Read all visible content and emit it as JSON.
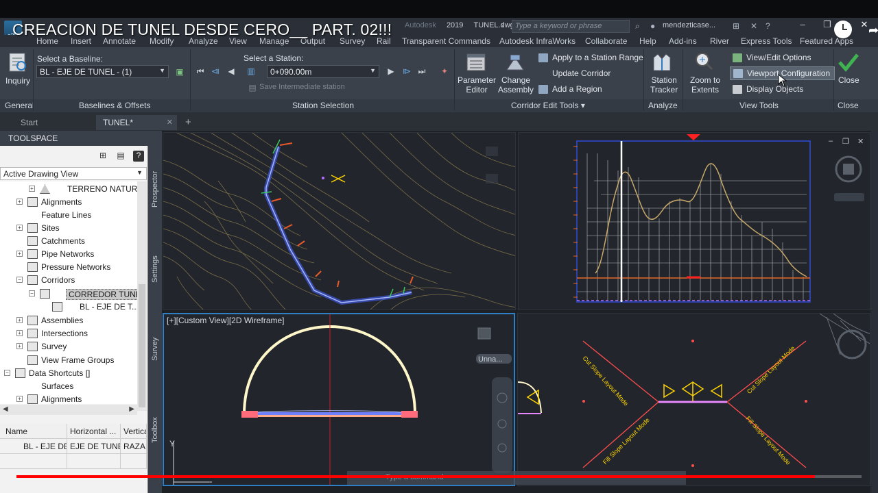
{
  "video_title": "CREACION DE TUNEL DESDE CERO__ PART. 02!!!",
  "window": {
    "app_logo": "c3D",
    "title_year_fragment": "2019",
    "title_file": "TUNEL.dwg",
    "title_prefix": "Autodesk",
    "search_placeholder": "Type a keyword or phrase",
    "user": "mendezticase..."
  },
  "ribbon_tabs": [
    "Home",
    "Insert",
    "Annotate",
    "Modify",
    "Analyze",
    "View",
    "Manage",
    "Output",
    "Survey",
    "Rail",
    "Transparent Commands",
    "Autodesk InfraWorks",
    "Collaborate",
    "Help",
    "Add-ins",
    "River",
    "Express Tools",
    "Featured Apps"
  ],
  "ribbon": {
    "general": {
      "inquiry_label": "Inquiry",
      "panel_title": "General"
    },
    "baselines": {
      "select_label": "Select a Baseline:",
      "baseline_value": "BL - EJE DE TUNEL - (1)",
      "panel_title": "Baselines & Offsets"
    },
    "station": {
      "select_label": "Select a Station:",
      "station_value": "0+090.00m",
      "save_label": "Save Intermediate station",
      "panel_title": "Station Selection"
    },
    "corridor_edit": {
      "parameter_editor": "Parameter\nEditor",
      "change_assembly": "Change\nAssembly",
      "apply_range": "Apply to a Station Range",
      "update_corridor": "Update Corridor",
      "add_region": "Add a Region",
      "panel_title": "Corridor Edit Tools ▾"
    },
    "analyze": {
      "station_tracker": "Station\nTracker",
      "panel_title": "Analyze"
    },
    "view_tools": {
      "zoom_extents": "Zoom to\nExtents",
      "view_edit_options": "View/Edit Options",
      "viewport_config": "Viewport Configuration",
      "display_objects": "Display Objects",
      "panel_title": "View Tools"
    },
    "close": {
      "label": "Close",
      "panel_title": "Close"
    }
  },
  "doc_tabs": {
    "start": "Start",
    "tunel": "TUNEL*",
    "add": "+"
  },
  "toolspace": {
    "title": "TOOLSPACE",
    "view_combo": "Active Drawing View",
    "side_tabs": [
      "Prospector",
      "Settings",
      "Survey",
      "Toolbox"
    ],
    "tree": [
      {
        "label": "TERRENO NATUR...",
        "level": 3
      },
      {
        "label": "Alignments",
        "level": 2,
        "pm": "+"
      },
      {
        "label": "Feature Lines",
        "level": 2
      },
      {
        "label": "Sites",
        "level": 2,
        "pm": "+"
      },
      {
        "label": "Catchments",
        "level": 2
      },
      {
        "label": "Pipe Networks",
        "level": 2,
        "pm": "+"
      },
      {
        "label": "Pressure Networks",
        "level": 2
      },
      {
        "label": "Corridors",
        "level": 2,
        "pm": "-"
      },
      {
        "label": "CORREDOR TUNEL",
        "level": 3,
        "pm": "-",
        "selected": true
      },
      {
        "label": "BL - EJE DE T...",
        "level": 4
      },
      {
        "label": "Assemblies",
        "level": 2,
        "pm": "+"
      },
      {
        "label": "Intersections",
        "level": 2,
        "pm": "+"
      },
      {
        "label": "Survey",
        "level": 2,
        "pm": "+"
      },
      {
        "label": "View Frame Groups",
        "level": 2
      },
      {
        "label": "Data Shortcuts []",
        "level": 1,
        "pm": "-"
      },
      {
        "label": "Surfaces",
        "level": 2
      },
      {
        "label": "Alignments",
        "level": 2
      }
    ],
    "table": {
      "headers": [
        "Name",
        "Horizontal ...",
        "Vertica"
      ],
      "row": [
        "BL - EJE DE",
        "EJE DE TUNEL",
        "RAZAN"
      ]
    }
  },
  "viewports": {
    "section_label": "[+][Custom View][2D Wireframe]",
    "section_unnamed": "Unna...",
    "assembly_labels": {
      "cut_left": "Cut Slope Layout Mode",
      "cut_right": "Cut Slope Layout Mode",
      "fill_left": "Fill Slope Layout Mode",
      "fill_right": "Fill Slope Layout Mode"
    },
    "y_axis_label": "Y"
  },
  "command_line": {
    "placeholder": "Type a command"
  },
  "video": {
    "progress_fraction": 0.945
  },
  "colors": {
    "accent": "#2f7fc6",
    "progress": "#ff0000",
    "profile_grid": "#ffffff",
    "profile_ground": "#c8a96a",
    "tunnel_outline": "#fff7c9",
    "assembly": "#ffd400"
  }
}
